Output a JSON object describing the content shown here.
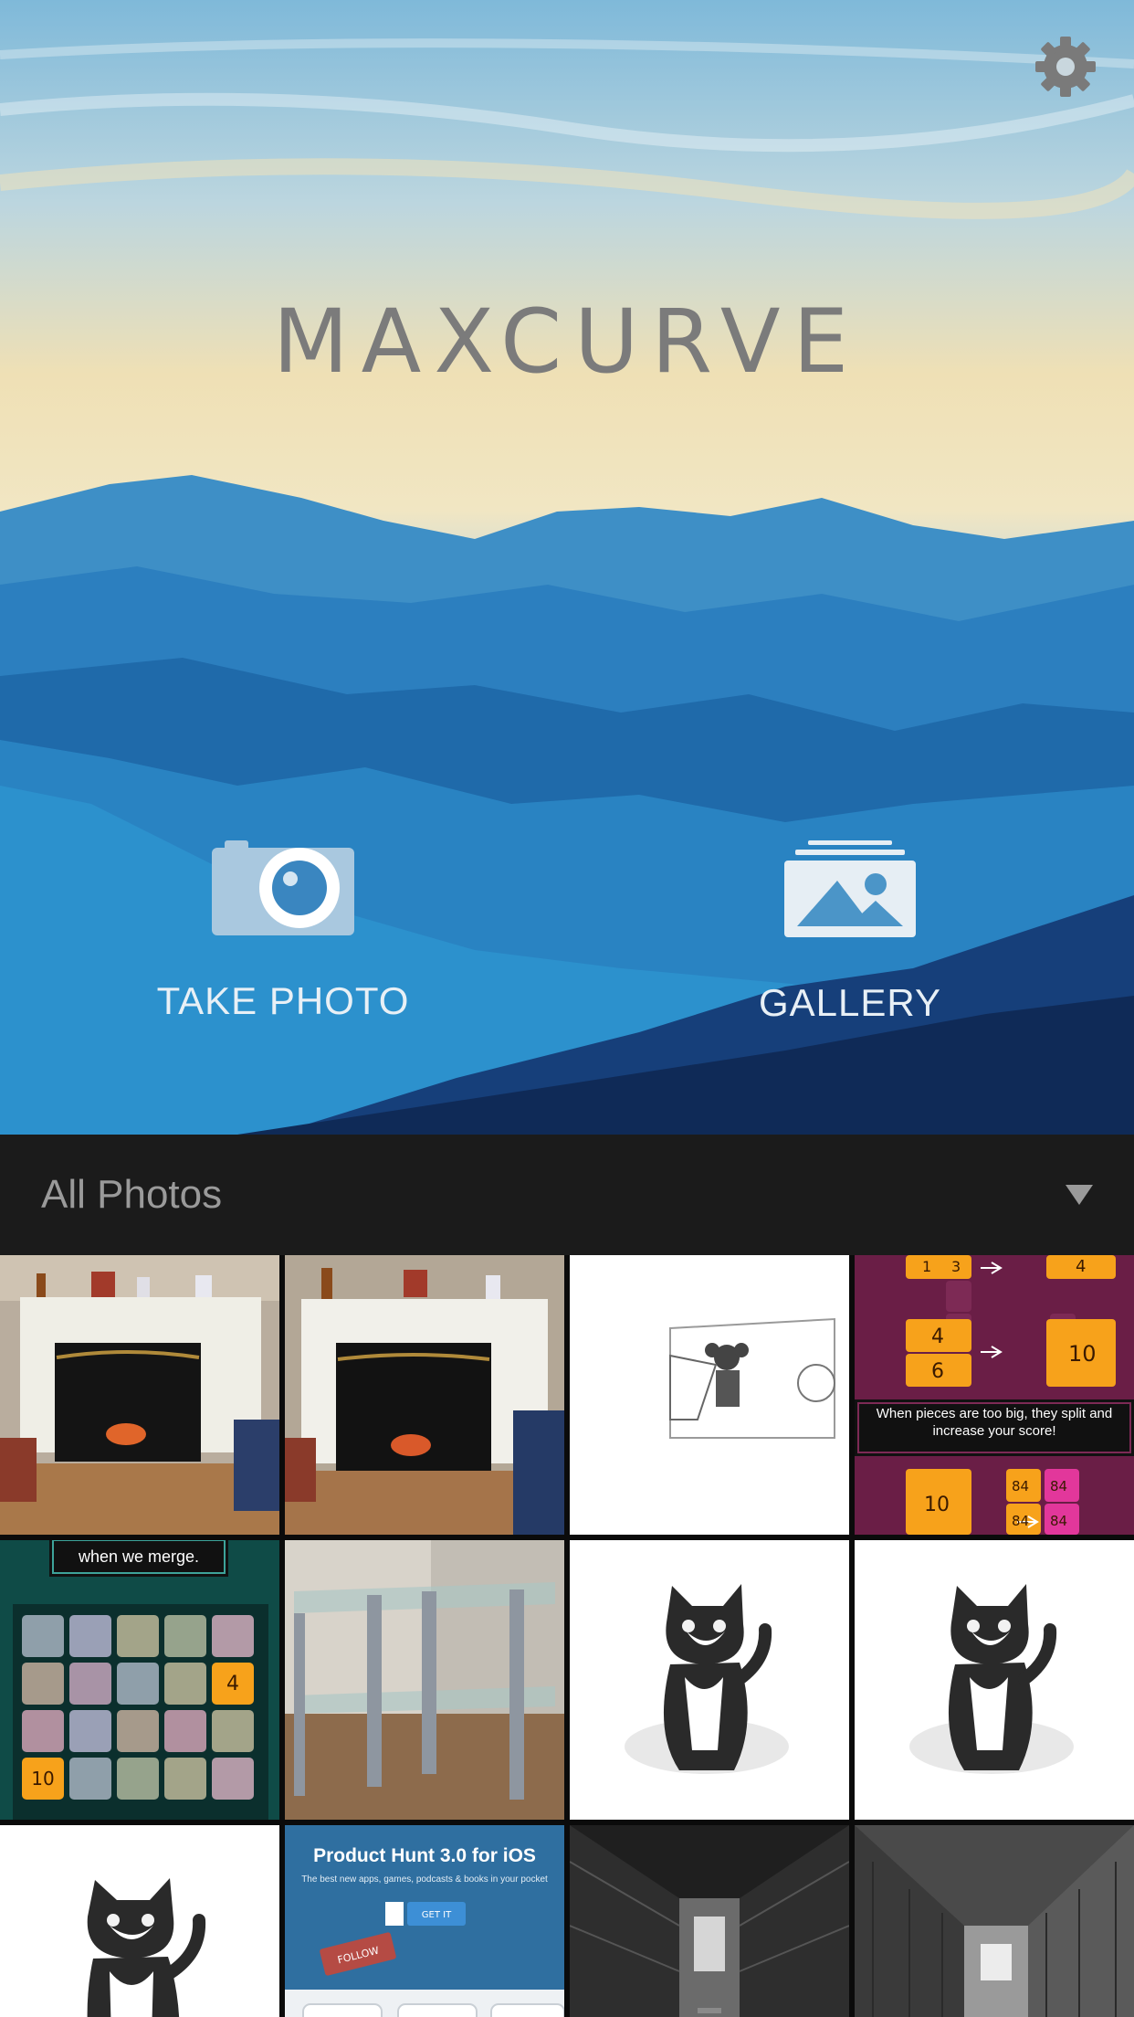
{
  "app": {
    "title": "MAXCURVE"
  },
  "header": {
    "settings_icon": "gear-icon"
  },
  "actions": {
    "take_photo": {
      "label": "TAKE PHOTO",
      "icon": "camera-icon"
    },
    "gallery": {
      "label": "GALLERY",
      "icon": "gallery-icon"
    }
  },
  "album_picker": {
    "selected": "All Photos",
    "icon": "dropdown-arrow-icon"
  },
  "photos": {
    "p4": {
      "t1": "1",
      "t2": "3",
      "t3": "4",
      "t4": "4",
      "t5": "6",
      "t6": "10",
      "caption": "When pieces are too big, they split and increase your score!",
      "t7": "10",
      "t8": "84",
      "t9": "84",
      "t10": "84",
      "t11": "84"
    },
    "p5": {
      "caption": "when we merge.",
      "t1": "4",
      "t2": "10"
    },
    "p10": {
      "title": "Product Hunt 3.0 for iOS",
      "subtitle": "The best new apps, games, podcasts & books in your pocket",
      "button": "GET IT",
      "follow": "FOLLOW"
    }
  },
  "colors": {
    "accent_tile": "#f7a21b",
    "pink_tile": "#e2379b",
    "bar_bg": "#1b1b1b"
  }
}
